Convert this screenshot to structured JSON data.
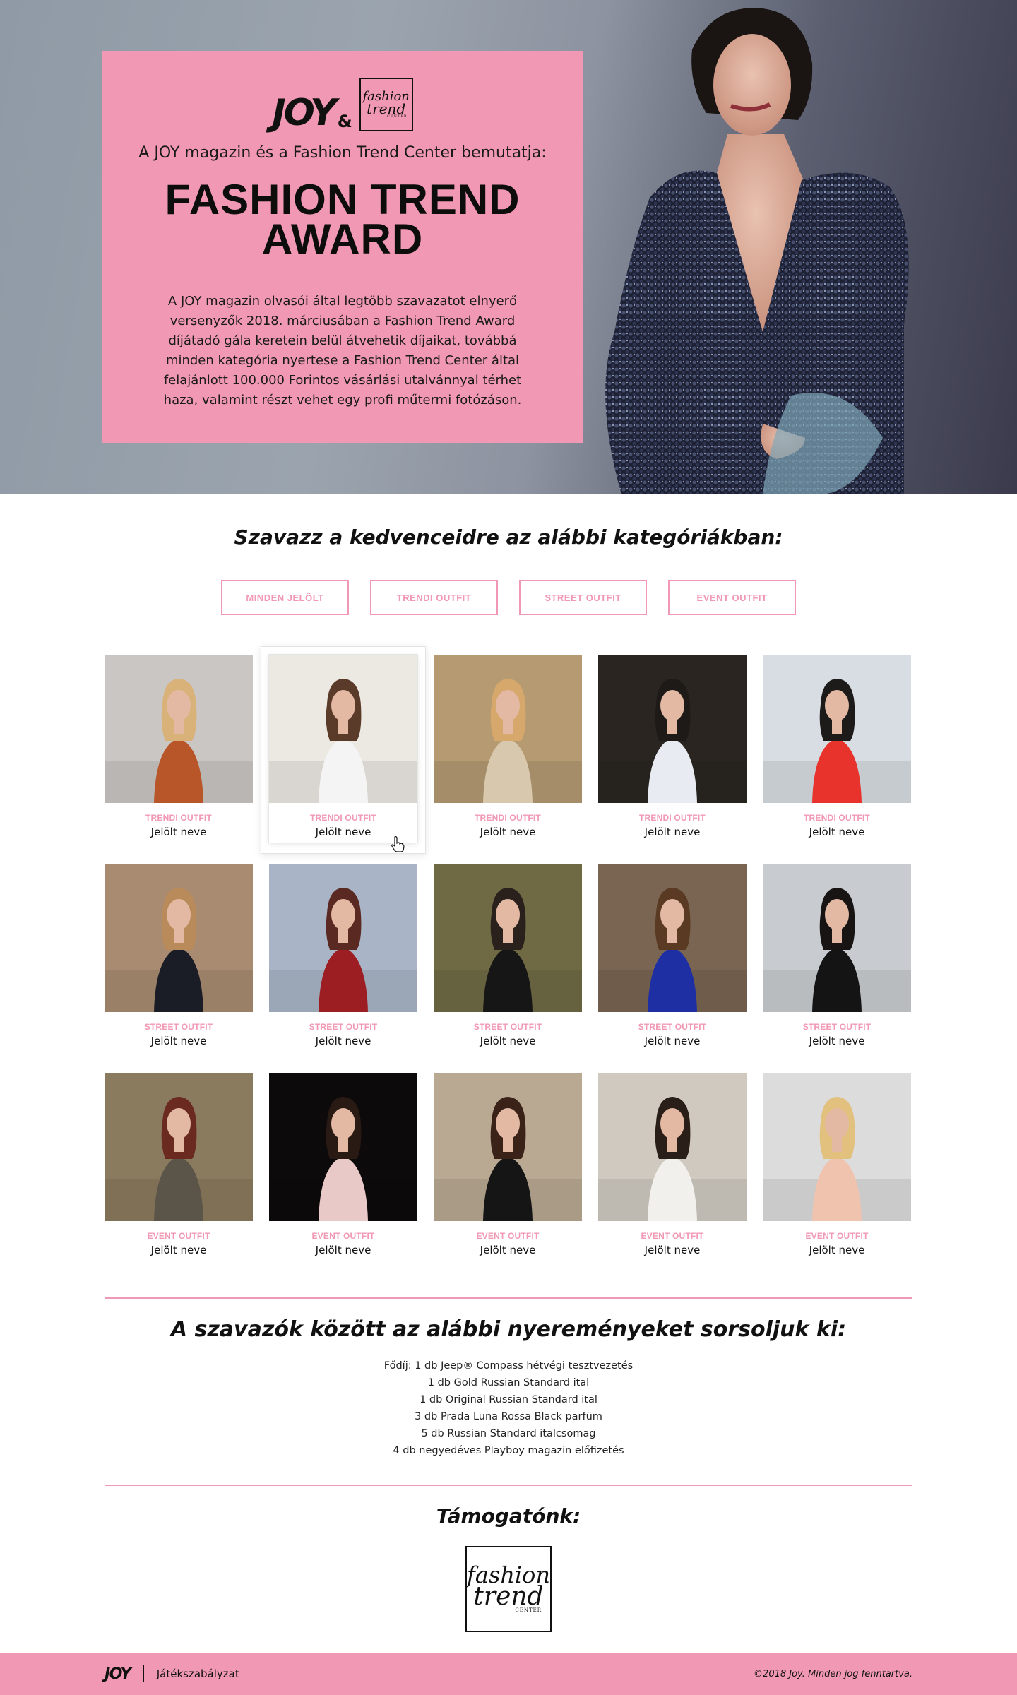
{
  "hero": {
    "logo_text": "JOY",
    "logo_amp": "&",
    "sponsor_logo": {
      "line1": "fashion",
      "line2": "trend",
      "line3": "CENTER"
    },
    "subtitle": "A JOY magazin és a Fashion Trend Center bemutatja:",
    "title_line1": "FASHION TREND",
    "title_line2": "AWARD",
    "body": "A JOY magazin olvasói által legtöbb szavazatot elnyerő versenyzők 2018. márciusában a Fashion Trend Award díjátadó gála keretein belül átvehetik díjaikat, továbbá minden kategória nyertese a Fashion Trend Center által felajánlott 100.000 Forintos vásárlási utalvánnyal térhet haza, valamint részt vehet egy profi műtermi fotózáson."
  },
  "vote": {
    "heading": "Szavazz a kedvenceidre az alábbi kategóriákban:",
    "filters": [
      "MINDEN JELÖLT",
      "TRENDI OUTFIT",
      "STREET OUTFIT",
      "EVENT OUTFIT"
    ]
  },
  "nominees": [
    {
      "category": "TRENDI OUTFIT",
      "name": "Jelölt neve",
      "bg": "#c9c6c4",
      "fg": "#b8562a",
      "hair": "#d9b27a"
    },
    {
      "category": "TRENDI OUTFIT",
      "name": "Jelölt neve",
      "bg": "#ece8e2",
      "fg": "#f4f4f4",
      "hair": "#5a3a28"
    },
    {
      "category": "TRENDI OUTFIT",
      "name": "Jelölt neve",
      "bg": "#b59a72",
      "fg": "#d8c9ae",
      "hair": "#d6a86b"
    },
    {
      "category": "TRENDI OUTFIT",
      "name": "Jelölt neve",
      "bg": "#2a2520",
      "fg": "#e8ecf2",
      "hair": "#1e1a18"
    },
    {
      "category": "TRENDI OUTFIT",
      "name": "Jelölt neve",
      "bg": "#d7dde2",
      "fg": "#e8322c",
      "hair": "#1d1a1a"
    },
    {
      "category": "STREET OUTFIT",
      "name": "Jelölt neve",
      "bg": "#a88b70",
      "fg": "#1b1d26",
      "hair": "#b98b5a"
    },
    {
      "category": "STREET OUTFIT",
      "name": "Jelölt neve",
      "bg": "#a9b5c6",
      "fg": "#9c1e22",
      "hair": "#5a2a22"
    },
    {
      "category": "STREET OUTFIT",
      "name": "Jelölt neve",
      "bg": "#6f6a44",
      "fg": "#161616",
      "hair": "#2a211c"
    },
    {
      "category": "STREET OUTFIT",
      "name": "Jelölt neve",
      "bg": "#7a6452",
      "fg": "#1d2fa3",
      "hair": "#5a3a22"
    },
    {
      "category": "STREET OUTFIT",
      "name": "Jelölt neve",
      "bg": "#c8ccd0",
      "fg": "#141414",
      "hair": "#181414"
    },
    {
      "category": "EVENT OUTFIT",
      "name": "Jelölt neve",
      "bg": "#8a7a5e",
      "fg": "#5a5548",
      "hair": "#6a2a20"
    },
    {
      "category": "EVENT OUTFIT",
      "name": "Jelölt neve",
      "bg": "#0c0a0a",
      "fg": "#e9c9c8",
      "hair": "#2a1a14"
    },
    {
      "category": "EVENT OUTFIT",
      "name": "Jelölt neve",
      "bg": "#b9a992",
      "fg": "#151515",
      "hair": "#3a2218"
    },
    {
      "category": "EVENT OUTFIT",
      "name": "Jelölt neve",
      "bg": "#cfc9c0",
      "fg": "#f2f0ec",
      "hair": "#2a1e18"
    },
    {
      "category": "EVENT OUTFIT",
      "name": "Jelölt neve",
      "bg": "#dcdcdc",
      "fg": "#efc3ae",
      "hair": "#e2c07e"
    }
  ],
  "prizes": {
    "heading": "A szavazók között az alábbi nyereményeket sorsoljuk ki:",
    "items": [
      "Fődíj: 1 db Jeep® Compass hétvégi tesztvezetés",
      "1 db Gold Russian Standard ital",
      "1 db Original Russian Standard ital",
      "3 db Prada Luna Rossa Black parfüm",
      "5 db Russian Standard italcsomag",
      "4 db negyedéves Playboy magazin előfizetés"
    ]
  },
  "sponsor": {
    "heading": "Támogatónk:",
    "logo": {
      "line1": "fashion",
      "line2": "trend",
      "line3": "CENTER"
    }
  },
  "footer": {
    "logo": "JOY",
    "rules_link": "Játékszabályzat",
    "copyright": "©2018 Joy. Minden jog fenntartva."
  },
  "colors": {
    "accent": "#f198b4"
  }
}
